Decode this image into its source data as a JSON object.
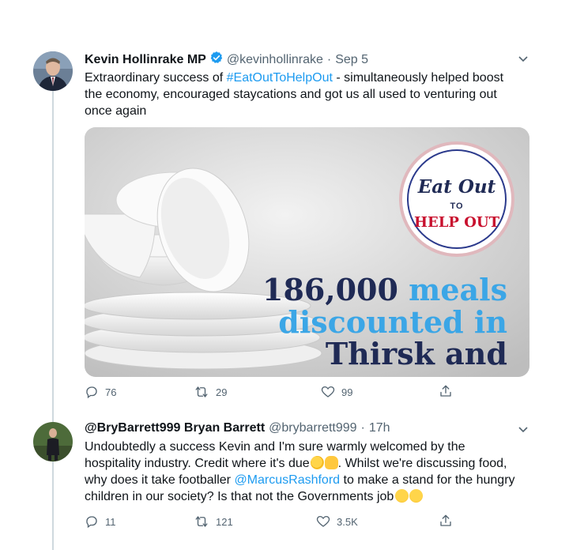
{
  "tweets": [
    {
      "display_name": "Kevin Hollinrake MP",
      "verified": true,
      "handle": "@kevinhollinrake",
      "separator": "·",
      "time": "Sep 5",
      "text_before": "Extraordinary success of ",
      "hashtag": "#EatOutToHelpOut",
      "text_after": " - simultaneously helped boost the economy, encouraged staycations and got us all used to venturing out once again",
      "media": {
        "logo_line1": "Eat Out",
        "logo_to": "TO",
        "logo_line2": "HELP OUT",
        "number": "186,000",
        "word_meals": "meals",
        "line2": "discounted in",
        "line3": "Thirsk and"
      },
      "actions": {
        "replies": "76",
        "retweets": "29",
        "likes": "99"
      }
    },
    {
      "display_name": "@BryBarrett999 Bryan Barrett",
      "verified": false,
      "handle": "@brybarrett999",
      "separator": "·",
      "time": "17h",
      "text_part1": "Undoubtedly a success Kevin and I'm sure warmly welcomed by the hospitality industry. Credit where it's due",
      "text_part2": ". Whilst we're discussing food, why does it take footballer ",
      "mention": "@MarcusRashford",
      "text_part3": " to make a stand for the hungry children in our society? Is that not the Governments job",
      "actions": {
        "replies": "11",
        "retweets": "121",
        "likes": "3.5K"
      }
    }
  ],
  "icons": [
    "verified-badge-icon",
    "chevron-down-icon",
    "reply-icon",
    "retweet-icon",
    "like-icon",
    "share-icon",
    "clapping-hands-emoji",
    "thumbs-up-emoji",
    "thinking-face-emoji"
  ],
  "colors": {
    "link": "#1d9bf0",
    "secondary_text": "#536471",
    "verified": "#1d9bf0",
    "card_navy": "#1f2a55",
    "card_blue": "#3ba6e6",
    "logo_red": "#c8102e"
  }
}
